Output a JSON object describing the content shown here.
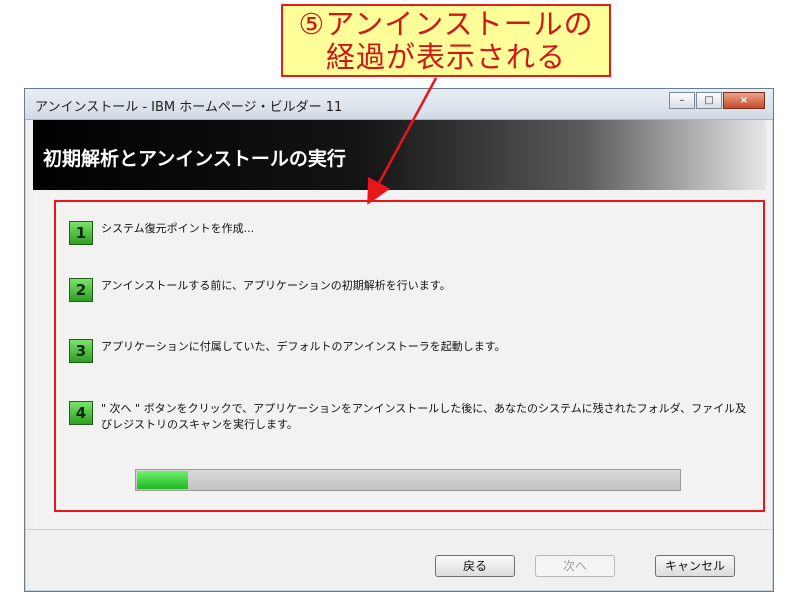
{
  "callout": {
    "lines": [
      "⑤アンインストールの",
      "経過が表示される"
    ]
  },
  "window": {
    "title": "アンインストール - IBM ホームページ・ビルダー 11",
    "controls": {
      "minimize": "–",
      "maximize": "□",
      "close": "×"
    }
  },
  "header": {
    "title": "初期解析とアンインストールの実行"
  },
  "steps": [
    {
      "number": "1",
      "text": "システム復元ポイントを作成..."
    },
    {
      "number": "2",
      "text": "アンインストールする前に、アプリケーションの初期解析を行います。"
    },
    {
      "number": "3",
      "text": "アプリケーションに付属していた、デフォルトのアンインストーラを起動します。"
    },
    {
      "number": "4",
      "text": "\" 次へ \" ボタンをクリックで、アプリケーションをアンインストールした後に、あなたのシステムに残されたフォルダ、ファイル及びレジストリのスキャンを実行します。"
    }
  ],
  "progress": {
    "fraction": 0.095
  },
  "buttons": {
    "back": "戻る",
    "next": "次へ",
    "cancel": "キャンセル"
  },
  "colors": {
    "highlight": "#e8151b",
    "callout_bg": "#ffff99",
    "progress": "#1fb81f",
    "step_icon": "#2f9e21"
  }
}
